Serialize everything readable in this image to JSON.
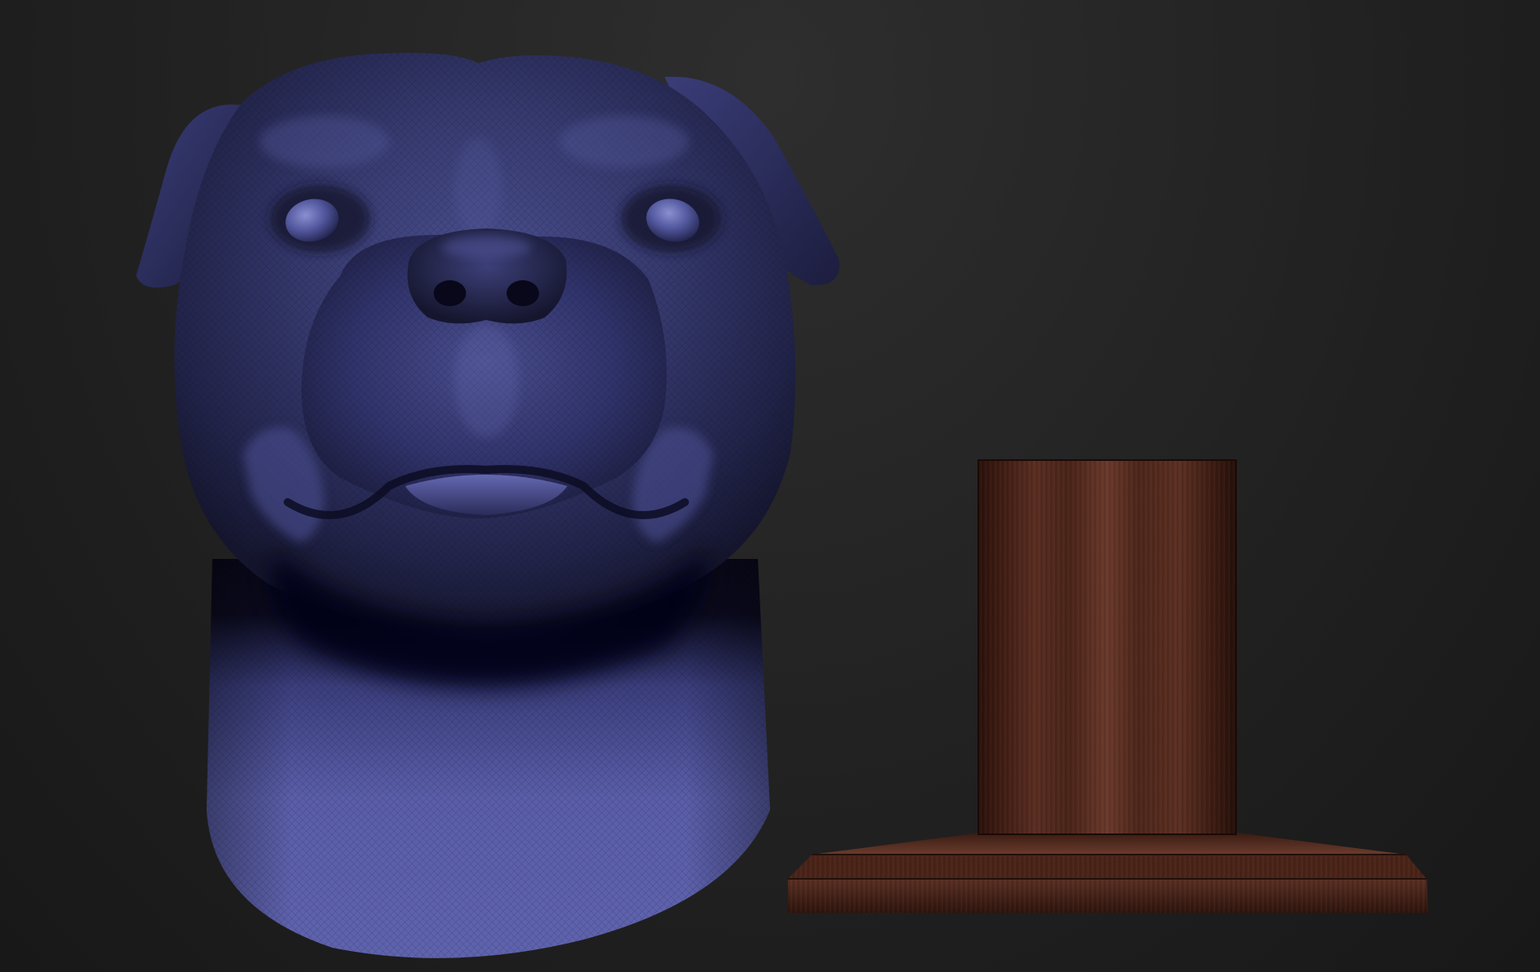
{
  "scene": {
    "background_color": "#242424",
    "objects": [
      {
        "name": "dog-head-sculpt",
        "material_color": "#5558a0"
      },
      {
        "name": "wooden-stand",
        "material_color": "#5a2f22"
      }
    ]
  }
}
